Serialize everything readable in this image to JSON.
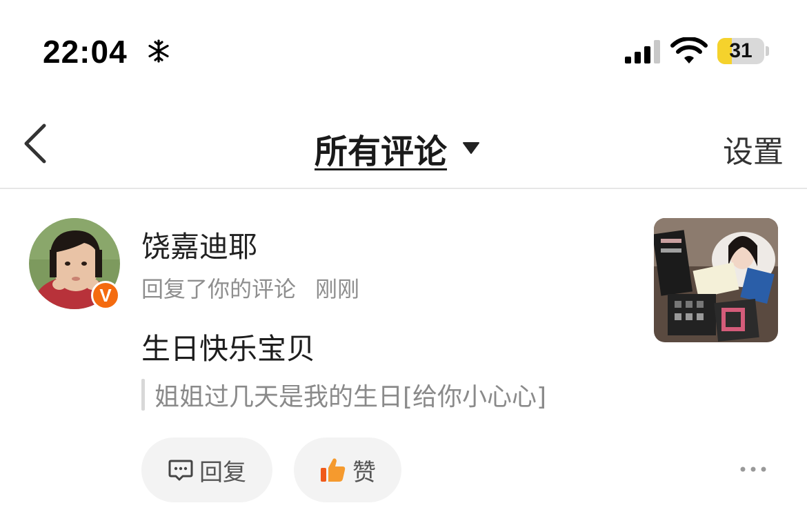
{
  "status_bar": {
    "time": "22:04",
    "battery_level": "31",
    "battery_fraction": 0.31,
    "icons": [
      "snowflake-icon",
      "cellular-signal-icon",
      "wifi-icon",
      "battery-icon"
    ]
  },
  "nav": {
    "title": "所有评论",
    "settings_label": "设置",
    "icons": [
      "chevron-left-icon",
      "caret-down-icon"
    ]
  },
  "comment": {
    "username": "饶嘉迪耶",
    "action": "回复了你的评论",
    "timestamp": "刚刚",
    "badge": "V",
    "text": "生日快乐宝贝",
    "quoted_text": "姐姐过几天是我的生日[给你小心心]",
    "reply_label": "回复",
    "like_label": "赞"
  },
  "colors": {
    "accent_orange": "#f46b10",
    "battery_yellow": "#f5d22c",
    "button_bg": "#f3f3f3",
    "secondary_text": "#8e8e8e"
  }
}
